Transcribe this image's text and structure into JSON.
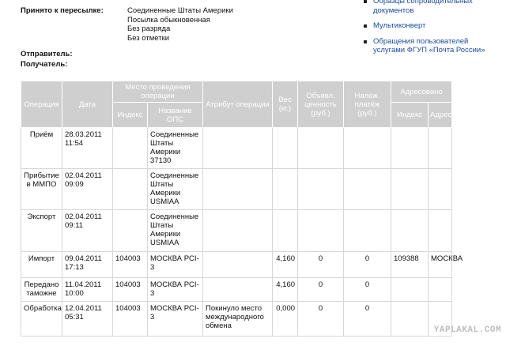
{
  "info": {
    "accepted_label": "Принято к пересылке:",
    "accepted_values": [
      "Соединенные Штаты Америки",
      "Посылка обыкновенная",
      "Без разряда",
      "Без отметки"
    ],
    "sender_label": "Отправитель:",
    "recipient_label": "Получатель:"
  },
  "sidebar": {
    "items": [
      "Образцы сопроводительных документов",
      "Мультиконверт",
      "Обращения пользователей услугами ФГУП «Почта России»"
    ]
  },
  "table": {
    "headers": {
      "operation": "Операция",
      "date": "Дата",
      "place": "Место проведения операции",
      "index": "Индекс",
      "ops_name": "Название ОПС",
      "attribute": "Атрибут операции",
      "weight": "Вес (кг.)",
      "declared": "Объявл. ценность (руб.)",
      "cod": "Налож. платёж (руб.)",
      "addressed": "Адресовано",
      "addr_index": "Индекс",
      "address": "Адрес"
    },
    "rows": [
      {
        "op": "Приём",
        "date": "28.03.2011\n11:54",
        "idx": "",
        "name": "Соединенные\nШтаты\nАмерики\n37130",
        "attr": "",
        "w": "",
        "dv": "",
        "cod": "",
        "aidx": "",
        "addr": ""
      },
      {
        "op": "Прибытие\nв ММПО",
        "date": "02.04.2011\n09:09",
        "idx": "",
        "name": "Соединенные\nШтаты\nАмерики\nUSMIAA",
        "attr": "",
        "w": "",
        "dv": "",
        "cod": "",
        "aidx": "",
        "addr": ""
      },
      {
        "op": "Экспорт",
        "date": "02.04.2011\n09:11",
        "idx": "",
        "name": "Соединенные\nШтаты\nАмерики\nUSMIAA",
        "attr": "",
        "w": "",
        "dv": "",
        "cod": "",
        "aidx": "",
        "addr": ""
      },
      {
        "op": "Импорт",
        "date": "09.04.2011\n17:13",
        "idx": "104003",
        "name": "МОСКВА PCI-\n3",
        "attr": "",
        "w": "4,160",
        "dv": "0",
        "cod": "0",
        "aidx": "109388",
        "addr": "МОСКВА"
      },
      {
        "op": "Передано\nтаможне",
        "date": "11.04.2011\n10:00",
        "idx": "104003",
        "name": "МОСКВА PCI-\n3",
        "attr": "",
        "w": "4,160",
        "dv": "0",
        "cod": "0",
        "aidx": "",
        "addr": ""
      },
      {
        "op": "Обработка",
        "date": "12.04.2011\n05:31",
        "idx": "104003",
        "name": "МОСКВА PCI-\n3",
        "attr": "Покинуло место\nмеждународного\nобмена",
        "w": "0,000",
        "dv": "0",
        "cod": "0",
        "aidx": "",
        "addr": ""
      }
    ]
  },
  "watermark": "YAPLAKAL.COM"
}
